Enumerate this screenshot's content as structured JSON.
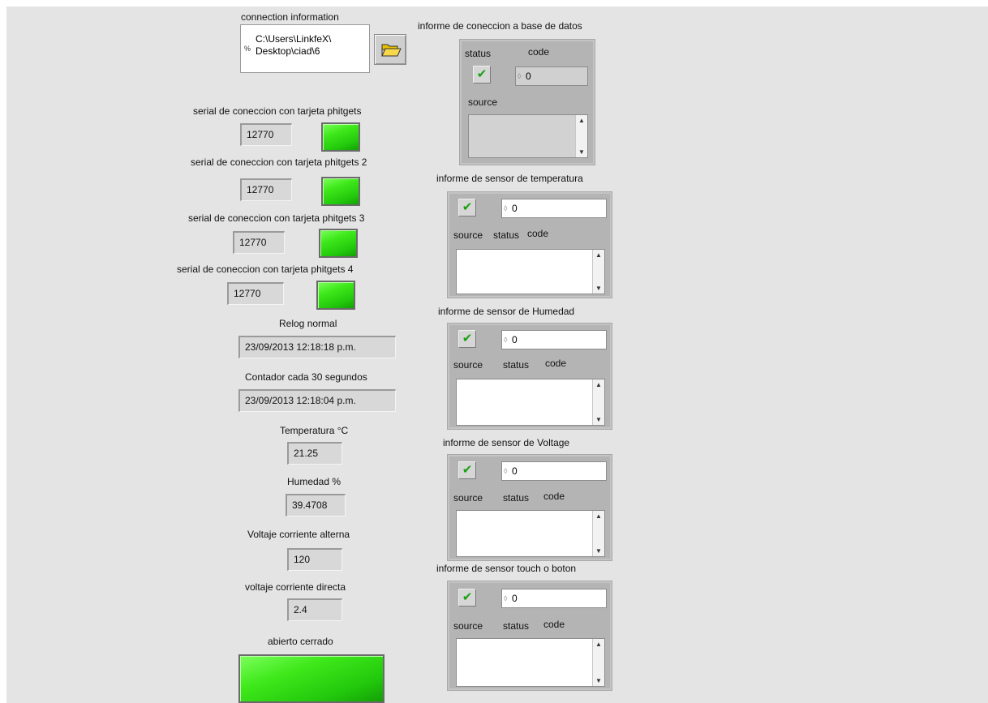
{
  "connection": {
    "label": "connection information",
    "path_line1": "C:\\Users\\LinkfeX\\",
    "path_line2": "Desktop\\ciad\\6",
    "path_marker": "%"
  },
  "serials": [
    {
      "label": "serial de coneccion con tarjeta phitgets",
      "value": "12770"
    },
    {
      "label": "serial de coneccion con tarjeta phitgets 2",
      "value": "12770"
    },
    {
      "label": "serial de coneccion con tarjeta phitgets 3",
      "value": "12770"
    },
    {
      "label": "serial de coneccion con tarjeta phitgets 4",
      "value": "12770"
    }
  ],
  "clock": {
    "label": "Relog  normal",
    "value": "23/09/2013 12:18:18 p.m."
  },
  "counter": {
    "label": "Contador cada 30 segundos",
    "value": "23/09/2013 12:18:04 p.m."
  },
  "temperature": {
    "label": "Temperatura °C",
    "value": "21.25"
  },
  "humidity": {
    "label": "Humedad %",
    "value": "39.4708"
  },
  "vac": {
    "label": "Voltaje corriente alterna",
    "value": "120"
  },
  "vdc": {
    "label": "voltaje corriente directa",
    "value": "2.4"
  },
  "door": {
    "label": "abierto cerrado"
  },
  "db_cluster": {
    "title": "informe de coneccion a base de datos",
    "status_label": "status",
    "code_label": "code",
    "code_value": "0",
    "source_label": "source"
  },
  "clusters": [
    {
      "title": "informe de sensor de temperatura",
      "code_value": "0",
      "source_label": "source",
      "status_label": "status",
      "code_label": "code"
    },
    {
      "title": "informe de sensor de Humedad",
      "code_value": "0",
      "source_label": "source",
      "status_label": "status",
      "code_label": "code"
    },
    {
      "title": "informe de sensor de Voltage",
      "code_value": "0",
      "source_label": "source",
      "status_label": "status",
      "code_label": "code"
    },
    {
      "title": "informe de sensor touch o boton",
      "code_value": "0",
      "source_label": "source",
      "status_label": "status",
      "code_label": "code"
    }
  ],
  "glyphs": {
    "check": "✔",
    "up": "▲",
    "down": "▼",
    "increment": "◊"
  },
  "colors": {
    "led_on": "#3ee81a",
    "panel_bg": "#e4e4e4",
    "check_green": "#1aa010"
  }
}
